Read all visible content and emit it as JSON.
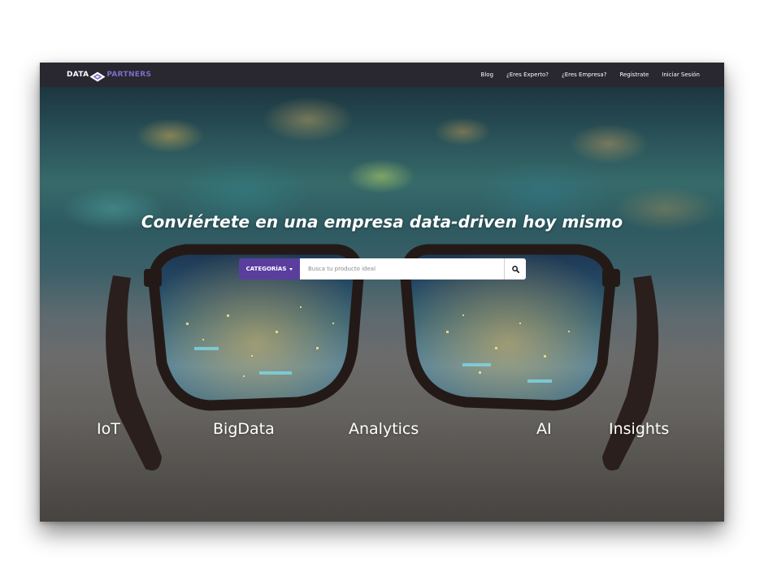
{
  "logo": {
    "part1": "DATA",
    "part2": "PARTNERS"
  },
  "nav": {
    "items": [
      {
        "label": "Blog"
      },
      {
        "label": "¿Eres Experto?"
      },
      {
        "label": "¿Eres Empresa?"
      },
      {
        "label": "Regístrate"
      },
      {
        "label": "Iniciar Sesión"
      }
    ]
  },
  "hero": {
    "headline": "Conviértete en una empresa data-driven hoy mismo",
    "categories_button": "CATEGORÍAS",
    "search_placeholder": "Busca tu producto ideal",
    "tags": [
      {
        "label": "IoT"
      },
      {
        "label": "BigData"
      },
      {
        "label": "Analytics"
      },
      {
        "label": "AI"
      },
      {
        "label": "Insights"
      }
    ]
  },
  "icons": {
    "search": "search-icon",
    "caret": "caret-down-icon",
    "logo_mark": "diamond-icon"
  },
  "colors": {
    "navbar": "#29272f",
    "accent": "#5a3e9e",
    "logo_accent": "#7e6cc8"
  }
}
